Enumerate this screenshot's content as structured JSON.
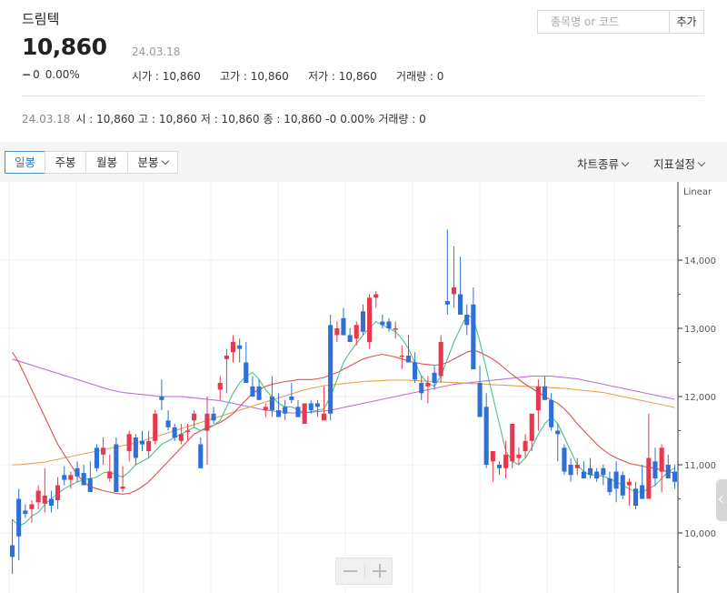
{
  "stock": {
    "name": "드림텍",
    "price": "10,860",
    "date": "24.03.18",
    "change": "0",
    "change_rate": "0.00%"
  },
  "summary": {
    "open_label": "시가 : ",
    "open": "10,860",
    "high_label": "고가 : ",
    "high": "10,860",
    "low_label": "저가 : ",
    "low": "10,860",
    "volume_label": "거래량 : ",
    "volume": "0"
  },
  "search": {
    "placeholder": "종목명 or 코드",
    "add_label": "추가"
  },
  "ohlc": {
    "date": "24.03.18",
    "open": "시 : 10,860",
    "high": "고 : 10,860",
    "low": "저 : 10,860",
    "close": "종 : 10,860",
    "change": "-0",
    "rate": "0.00%",
    "volume": "거래량 : 0"
  },
  "toolbar": {
    "tabs": [
      "일봉",
      "주봉",
      "월봉",
      "분봉"
    ],
    "active_tab": "일봉",
    "chart_type_label": "차트종류",
    "indicator_label": "지표설정"
  },
  "colors": {
    "up": "#e8384f",
    "down": "#2f6fd6",
    "ma5": "#4cc28a",
    "ma20": "#d9534f",
    "ma60": "#e8a04a",
    "ma120": "#b56ee0"
  },
  "icons": {
    "zoom_out": "minus-icon",
    "zoom_in": "plus-icon",
    "side_panel": "chevron-left-icon"
  },
  "chart_data": {
    "type": "candlestick",
    "scale_label": "Linear",
    "y_ticks": [
      10000,
      11000,
      12000,
      13000,
      14000
    ],
    "ylim": [
      9300,
      14750
    ],
    "candles": [
      [
        9820,
        10200,
        9400,
        9650
      ],
      [
        10500,
        10650,
        9600,
        9950
      ],
      [
        10330,
        10420,
        10220,
        10280
      ],
      [
        10350,
        10480,
        10150,
        10420
      ],
      [
        10450,
        10700,
        10350,
        10620
      ],
      [
        10430,
        10950,
        10300,
        10550
      ],
      [
        10500,
        10620,
        10300,
        10400
      ],
      [
        10480,
        10820,
        10350,
        10700
      ],
      [
        10850,
        10980,
        10700,
        10780
      ],
      [
        10780,
        10900,
        10650,
        10850
      ],
      [
        10950,
        11050,
        10750,
        10830
      ],
      [
        10880,
        11000,
        10750,
        10700
      ],
      [
        10800,
        11050,
        10650,
        10600
      ],
      [
        11250,
        11300,
        10900,
        10950
      ],
      [
        11150,
        11400,
        11000,
        11250
      ],
      [
        10800,
        11150,
        10750,
        10900
      ],
      [
        11300,
        11400,
        10600,
        10600
      ],
      [
        10650,
        10980,
        10600,
        10680
      ],
      [
        11200,
        11500,
        11050,
        11450
      ],
      [
        11400,
        11450,
        11000,
        11100
      ],
      [
        11350,
        11500,
        11200,
        11300
      ],
      [
        11200,
        11500,
        11100,
        11350
      ],
      [
        11350,
        11800,
        11300,
        11750
      ],
      [
        12000,
        12250,
        11800,
        11950
      ],
      [
        11650,
        11800,
        11500,
        11550
      ],
      [
        11550,
        11600,
        11350,
        11400
      ],
      [
        11350,
        11600,
        11300,
        11450
      ],
      [
        11500,
        11600,
        11350,
        11500
      ],
      [
        11650,
        11800,
        11550,
        11750
      ],
      [
        11300,
        11400,
        10950,
        10950
      ],
      [
        11500,
        12000,
        11000,
        11750
      ],
      [
        11750,
        11850,
        11600,
        11650
      ],
      [
        12100,
        12300,
        11950,
        12200
      ],
      [
        12550,
        12700,
        12050,
        12600
      ],
      [
        12650,
        12900,
        12500,
        12800
      ],
      [
        12750,
        12850,
        12500,
        12700
      ],
      [
        12500,
        12800,
        12200,
        12200
      ],
      [
        12150,
        12300,
        12100,
        12000
      ],
      [
        12150,
        12250,
        11950,
        11950
      ],
      [
        11800,
        11900,
        11700,
        11850
      ],
      [
        12000,
        12300,
        11700,
        11800
      ],
      [
        11800,
        12050,
        11700,
        11700
      ],
      [
        11850,
        11950,
        11650,
        11750
      ],
      [
        12000,
        12200,
        11900,
        11950
      ],
      [
        11850,
        11950,
        11700,
        11700
      ],
      [
        11600,
        11800,
        11600,
        11900
      ],
      [
        11900,
        11950,
        11750,
        11800
      ],
      [
        11900,
        11950,
        11700,
        11850
      ],
      [
        11650,
        12150,
        11700,
        11750
      ],
      [
        13050,
        13200,
        11650,
        11750
      ],
      [
        12900,
        13100,
        12800,
        13000
      ],
      [
        13150,
        13300,
        12900,
        12900
      ],
      [
        12900,
        13000,
        12800,
        12800
      ],
      [
        12850,
        13100,
        12750,
        13050
      ],
      [
        13250,
        13350,
        12900,
        12950
      ],
      [
        12800,
        13500,
        12700,
        13450
      ],
      [
        13450,
        13550,
        13300,
        13500
      ],
      [
        13100,
        13200,
        13000,
        13050
      ],
      [
        13100,
        13150,
        12950,
        13000
      ],
      [
        13000,
        13100,
        12850,
        13000
      ],
      [
        12600,
        12750,
        12400,
        12600
      ],
      [
        12600,
        12900,
        12500,
        12500
      ],
      [
        12500,
        12650,
        12200,
        12250
      ],
      [
        12200,
        12300,
        11950,
        12050
      ],
      [
        12150,
        12300,
        11900,
        12200
      ],
      [
        12350,
        12450,
        12100,
        12200
      ],
      [
        12300,
        12900,
        12200,
        12800
      ],
      [
        13400,
        14450,
        13200,
        13350
      ],
      [
        13500,
        14200,
        13300,
        13600
      ],
      [
        13500,
        14050,
        13300,
        13200
      ],
      [
        13200,
        13350,
        12900,
        13050
      ],
      [
        13350,
        13600,
        12600,
        12400
      ],
      [
        12200,
        12450,
        11700,
        11700
      ],
      [
        11850,
        12050,
        10950,
        11000
      ],
      [
        11050,
        11200,
        10750,
        11200
      ],
      [
        11000,
        11050,
        10850,
        10950
      ],
      [
        10950,
        11350,
        10800,
        11150
      ],
      [
        11050,
        11550,
        10950,
        11600
      ],
      [
        11100,
        11250,
        11000,
        11150
      ],
      [
        11200,
        11450,
        11100,
        11350
      ],
      [
        11350,
        11550,
        11200,
        11750
      ],
      [
        11800,
        12250,
        11500,
        12150
      ],
      [
        12150,
        12300,
        11950,
        11950
      ],
      [
        11950,
        12050,
        11500,
        11550
      ],
      [
        11500,
        11600,
        11050,
        11450
      ],
      [
        11250,
        11300,
        10850,
        10900
      ],
      [
        11000,
        11100,
        10750,
        10850
      ],
      [
        10950,
        11100,
        10850,
        11000
      ],
      [
        10900,
        11050,
        10800,
        10800
      ],
      [
        10950,
        11100,
        10800,
        10850
      ],
      [
        10900,
        10950,
        10750,
        10800
      ],
      [
        10950,
        11000,
        10700,
        10850
      ],
      [
        10800,
        10900,
        10550,
        10600
      ],
      [
        10900,
        11050,
        10450,
        10650
      ],
      [
        10850,
        10900,
        10500,
        10550
      ],
      [
        10700,
        10800,
        10400,
        10750
      ],
      [
        10650,
        10750,
        10350,
        10400
      ],
      [
        10700,
        11000,
        10550,
        10500
      ],
      [
        10500,
        11750,
        10500,
        11100
      ],
      [
        11050,
        11250,
        10700,
        10800
      ],
      [
        10900,
        11300,
        10600,
        11250
      ],
      [
        11000,
        11150,
        10800,
        10800
      ],
      [
        10900,
        11000,
        10650,
        10750
      ]
    ],
    "ma5": [
      10200,
      10100,
      10150,
      10250,
      10300,
      10420,
      10500,
      10580,
      10650,
      10700,
      10750,
      10780,
      10800,
      10820,
      10880,
      10900,
      10850,
      10820,
      10900,
      11000,
      11050,
      11100,
      11200,
      11300,
      11350,
      11400,
      11450,
      11500,
      11550,
      11500,
      11520,
      11580,
      11650,
      11850,
      12050,
      12200,
      12300,
      12350,
      12250,
      12100,
      12000,
      11900,
      11850,
      11850,
      11800,
      11760,
      11780,
      11800,
      11820,
      12000,
      12250,
      12500,
      12650,
      12780,
      12900,
      13000,
      13100,
      13050,
      13000,
      12950,
      12850,
      12700,
      12500,
      12300,
      12200,
      12150,
      12300,
      12550,
      12800,
      13000,
      13200,
      13150,
      12800,
      12400,
      12000,
      11600,
      11200,
      11050,
      11000,
      11100,
      11250,
      11450,
      11600,
      11700,
      11600,
      11400,
      11200,
      11000,
      10900,
      10850,
      10850,
      10830,
      10800,
      10750,
      10700,
      10650,
      10600,
      10600,
      10650,
      10700,
      10800,
      10900,
      10950
    ],
    "ma20": [
      12650,
      12500,
      12300,
      12100,
      11900,
      11700,
      11500,
      11300,
      11150,
      11000,
      10850,
      10750,
      10680,
      10650,
      10620,
      10600,
      10580,
      10570,
      10580,
      10620,
      10680,
      10750,
      10850,
      10950,
      11050,
      11150,
      11250,
      11350,
      11450,
      11500,
      11550,
      11580,
      11620,
      11680,
      11750,
      11850,
      11950,
      12050,
      12100,
      12150,
      12180,
      12200,
      12220,
      12230,
      12250,
      12250,
      12250,
      12260,
      12280,
      12320,
      12350,
      12400,
      12450,
      12500,
      12550,
      12580,
      12600,
      12620,
      12600,
      12580,
      12550,
      12520,
      12500,
      12480,
      12470,
      12460,
      12470,
      12500,
      12550,
      12600,
      12650,
      12680,
      12650,
      12600,
      12550,
      12480,
      12400,
      12320,
      12250,
      12180,
      12120,
      12060,
      12000,
      11950,
      11900,
      11820,
      11720,
      11600,
      11500,
      11400,
      11300,
      11220,
      11150,
      11100,
      11060,
      11020,
      11000,
      10980,
      10960,
      10950,
      10920,
      10900,
      10880
    ],
    "ma60": [
      11000,
      11000,
      11010,
      11020,
      11030,
      11040,
      11060,
      11080,
      11100,
      11120,
      11140,
      11160,
      11180,
      11200,
      11220,
      11240,
      11260,
      11280,
      11300,
      11320,
      11350,
      11380,
      11410,
      11440,
      11470,
      11500,
      11530,
      11560,
      11590,
      11620,
      11650,
      11680,
      11710,
      11740,
      11770,
      11800,
      11830,
      11860,
      11890,
      11920,
      11950,
      11980,
      12010,
      12040,
      12070,
      12100,
      12120,
      12140,
      12160,
      12170,
      12180,
      12190,
      12200,
      12210,
      12220,
      12225,
      12230,
      12235,
      12240,
      12240,
      12240,
      12240,
      12235,
      12230,
      12225,
      12220,
      12215,
      12210,
      12205,
      12200,
      12195,
      12190,
      12185,
      12180,
      12175,
      12170,
      12165,
      12160,
      12155,
      12150,
      12145,
      12140,
      12135,
      12130,
      12125,
      12120,
      12110,
      12100,
      12090,
      12080,
      12070,
      12060,
      12040,
      12020,
      12000,
      11980,
      11960,
      11940,
      11920,
      11900,
      11880,
      11860,
      11840
    ],
    "ma120": [
      12550,
      12520,
      12490,
      12460,
      12430,
      12400,
      12370,
      12340,
      12310,
      12280,
      12250,
      12220,
      12190,
      12160,
      12130,
      12100,
      12080,
      12060,
      12050,
      12040,
      12030,
      12020,
      12010,
      12000,
      12000,
      12000,
      12000,
      11990,
      11980,
      11970,
      11960,
      11950,
      11940,
      11920,
      11900,
      11880,
      11860,
      11840,
      11820,
      11800,
      11790,
      11780,
      11770,
      11760,
      11760,
      11760,
      11770,
      11780,
      11790,
      11800,
      11820,
      11840,
      11860,
      11880,
      11900,
      11920,
      11940,
      11960,
      11980,
      12000,
      12020,
      12040,
      12060,
      12080,
      12100,
      12120,
      12140,
      12160,
      12180,
      12190,
      12200,
      12210,
      12220,
      12230,
      12240,
      12250,
      12260,
      12270,
      12280,
      12290,
      12300,
      12300,
      12300,
      12300,
      12290,
      12280,
      12270,
      12260,
      12240,
      12220,
      12200,
      12180,
      12160,
      12140,
      12120,
      12100,
      12080,
      12060,
      12040,
      12020,
      12000,
      11980,
      11960
    ]
  }
}
